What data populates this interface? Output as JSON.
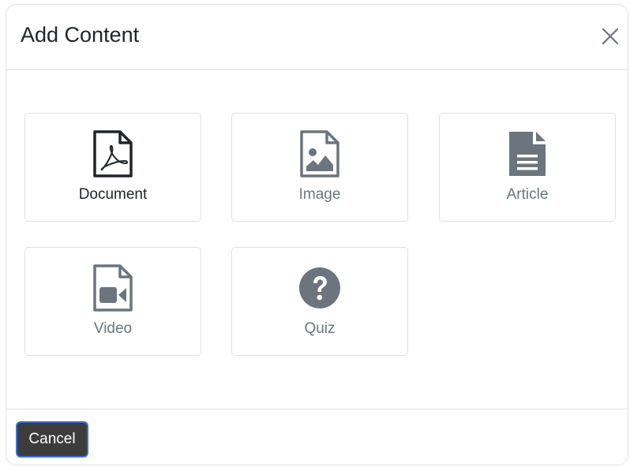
{
  "modal": {
    "title": "Add Content",
    "close_icon": "close-icon"
  },
  "content_types": [
    {
      "label": "Document",
      "icon": "pdf-file-icon"
    },
    {
      "label": "Image",
      "icon": "image-file-icon"
    },
    {
      "label": "Article",
      "icon": "article-file-icon"
    },
    {
      "label": "Video",
      "icon": "video-file-icon"
    },
    {
      "label": "Quiz",
      "icon": "question-circle-icon"
    }
  ],
  "footer": {
    "cancel_label": "Cancel"
  },
  "colors": {
    "icon_dark": "#212529",
    "icon_gray": "#6c757d",
    "border": "#dee2e6",
    "cancel_bg": "#3c3c3c",
    "cancel_focus": "#3b6fd6"
  }
}
